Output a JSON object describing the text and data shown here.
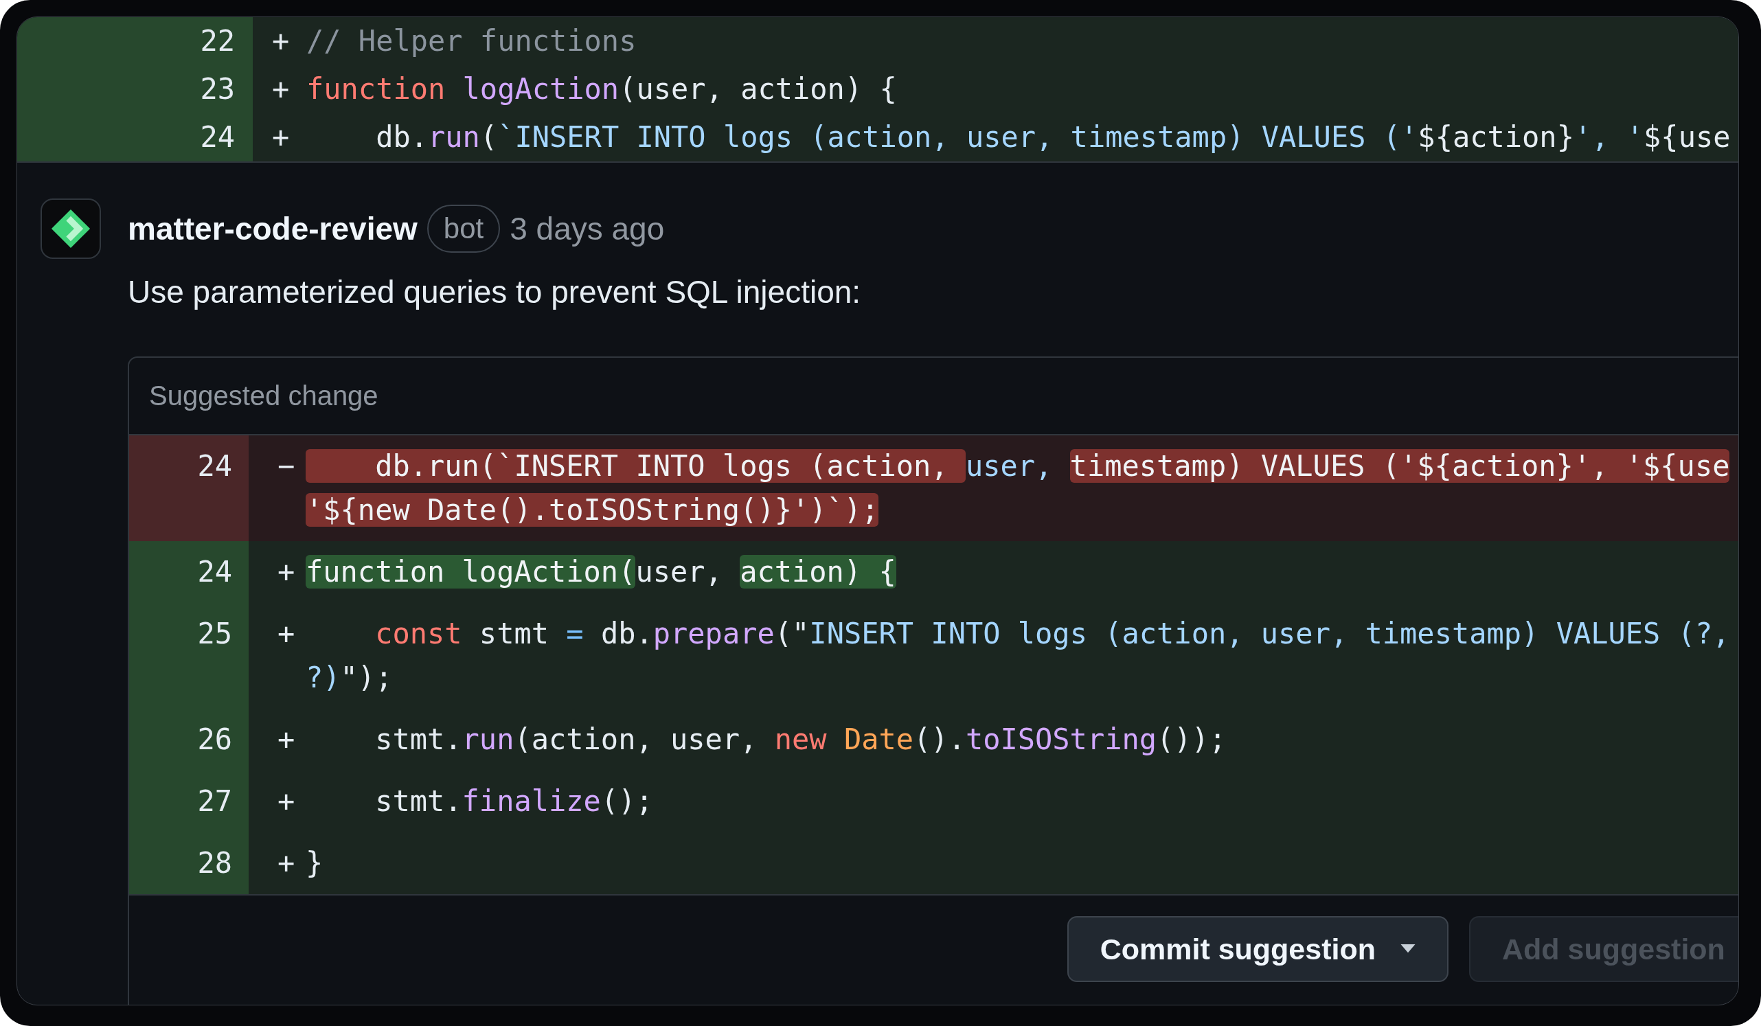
{
  "diff_context": {
    "lines": [
      {
        "number": "22",
        "sign": "+",
        "kind": "added",
        "segments": [
          [
            {
              "t": "// Helper functions",
              "kind": "comment"
            }
          ]
        ]
      },
      {
        "number": "23",
        "sign": "+",
        "kind": "added",
        "segments": [
          [
            {
              "t": "function",
              "kind": "keyword"
            },
            {
              "t": " logAction",
              "kind": "function"
            },
            {
              "t": "(user, action) {",
              "kind": "plain"
            }
          ]
        ]
      },
      {
        "number": "24",
        "sign": "+",
        "kind": "added",
        "segments": [
          [
            {
              "t": "    db.",
              "kind": "plain"
            },
            {
              "t": "run",
              "kind": "function"
            },
            {
              "t": "(",
              "kind": "plain"
            },
            {
              "t": "`INSERT INTO logs (action, user, timestamp) VALUES ('",
              "kind": "string"
            },
            {
              "t": "${action}",
              "kind": "plain"
            },
            {
              "t": "', '",
              "kind": "string"
            },
            {
              "t": "${use",
              "kind": "plain"
            }
          ]
        ]
      }
    ]
  },
  "comment": {
    "author": "matter-code-review",
    "badge": "bot",
    "time": "3 days ago",
    "body": "Use parameterized queries to prevent SQL injection:",
    "suggestion": {
      "title": "Suggested change",
      "lines": [
        {
          "number": "24",
          "sign": "−",
          "kind": "removed",
          "segments": [
            [
              {
                "t": "    db.run(`INSERT INTO logs (action, ",
                "kind": "plain",
                "hl": true
              },
              {
                "t": "user, ",
                "kind": "string",
                "hl": false
              },
              {
                "t": "timestamp) VALUES ('${action}', '${use",
                "kind": "plain",
                "hl": true
              }
            ],
            [
              {
                "t": "'${new Date().toISOString()}')`);",
                "kind": "plain",
                "hl": true
              }
            ]
          ]
        },
        {
          "number": "24",
          "sign": "+",
          "kind": "added",
          "segments": [
            [
              {
                "t": "function logAction(",
                "kind": "plain",
                "hl": true
              },
              {
                "t": "user, ",
                "kind": "plain",
                "hl": false
              },
              {
                "t": "action) {",
                "kind": "plain",
                "hl": true
              }
            ]
          ]
        },
        {
          "number": "25",
          "sign": "+",
          "kind": "added",
          "segments": [
            [
              {
                "t": "    const",
                "kind": "keyword",
                "hl": false
              },
              {
                "t": " stmt ",
                "kind": "plain",
                "hl": false
              },
              {
                "t": "=",
                "kind": "operator",
                "hl": false
              },
              {
                "t": " db.",
                "kind": "plain",
                "hl": false
              },
              {
                "t": "prepare",
                "kind": "function",
                "hl": false
              },
              {
                "t": "(\"",
                "kind": "plain",
                "hl": false
              },
              {
                "t": "INSERT INTO logs (action, user, timestamp) VALUES (?,",
                "kind": "string",
                "hl": false
              }
            ],
            [
              {
                "t": "?)",
                "kind": "string",
                "hl": false
              },
              {
                "t": "\");",
                "kind": "plain",
                "hl": false
              }
            ]
          ]
        },
        {
          "number": "26",
          "sign": "+",
          "kind": "added",
          "segments": [
            [
              {
                "t": "    stmt.",
                "kind": "plain",
                "hl": false
              },
              {
                "t": "run",
                "kind": "function",
                "hl": false
              },
              {
                "t": "(action, user, ",
                "kind": "plain",
                "hl": false
              },
              {
                "t": "new ",
                "kind": "keyword",
                "hl": false
              },
              {
                "t": "Date",
                "kind": "type",
                "hl": false
              },
              {
                "t": "().",
                "kind": "plain",
                "hl": false
              },
              {
                "t": "toISOString",
                "kind": "function",
                "hl": false
              },
              {
                "t": "());",
                "kind": "plain",
                "hl": false
              }
            ]
          ]
        },
        {
          "number": "27",
          "sign": "+",
          "kind": "added",
          "segments": [
            [
              {
                "t": "    stmt.",
                "kind": "plain",
                "hl": false
              },
              {
                "t": "finalize",
                "kind": "function",
                "hl": false
              },
              {
                "t": "();",
                "kind": "plain",
                "hl": false
              }
            ]
          ]
        },
        {
          "number": "28",
          "sign": "+",
          "kind": "added",
          "segments": [
            [
              {
                "t": "}",
                "kind": "plain",
                "hl": false
              }
            ]
          ]
        }
      ],
      "actions": [
        {
          "label": "Commit suggestion",
          "disabled": false,
          "dropdown": true
        },
        {
          "label": "Add suggestion",
          "disabled": true,
          "dropdown": false
        }
      ]
    }
  }
}
